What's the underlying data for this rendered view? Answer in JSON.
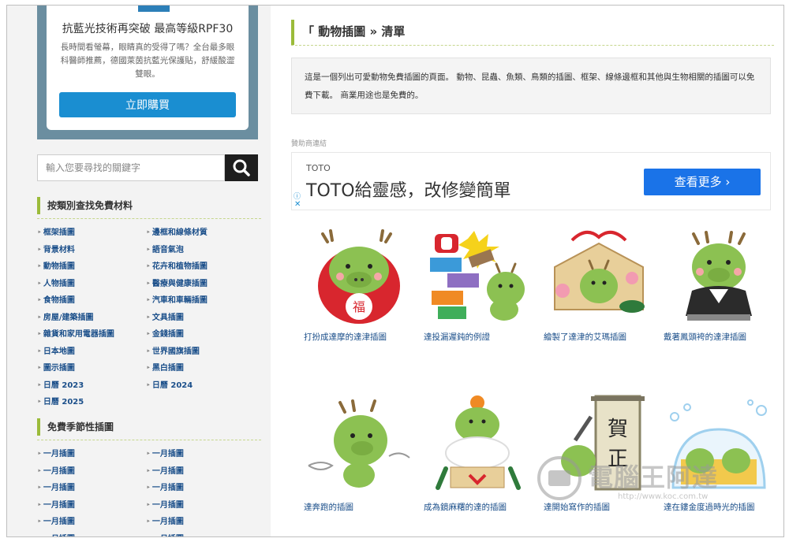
{
  "sidebar": {
    "ad": {
      "title": "抗藍光技術再突破 最高等級RPF30",
      "description": "長時間看螢幕，眼睛真的受得了嗎？全台最多眼科醫師推薦，德國萊茵抗藍光保護貼，舒緩酸澀雙眼。",
      "button": "立即購買"
    },
    "search": {
      "placeholder": "輸入您要尋找的關鍵字",
      "icon": "search-icon"
    },
    "categories_title": "按類別查找免費材料",
    "categories": [
      "框架插圖",
      "邊框和線條材質",
      "背景材料",
      "語音氣泡",
      "動物插圖",
      "花卉和植物插圖",
      "人物插圖",
      "醫療與健康插圖",
      "食物插圖",
      "汽車和車輛插圖",
      "房屋/建築插圖",
      "文具插圖",
      "雜貨和家用電器插圖",
      "金錢插圖",
      "日本地圖",
      "世界國旗插圖",
      "圖示插圖",
      "黑白插圖",
      "日曆 2023",
      "日曆 2024",
      "日曆 2025"
    ],
    "seasonal_title": "免費季節性插圖",
    "seasonal": [
      "一月插圖",
      "一月插圖",
      "一月插圖",
      "一月插圖",
      "一月插圖",
      "一月插圖",
      "一月插圖",
      "一月插圖",
      "一月插圖",
      "一月插圖",
      "一月插圖",
      "一月插圖"
    ]
  },
  "main": {
    "heading": "「 動物插圖 » 清單",
    "intro": "這是一個列出可愛動物免費插圖的頁面。 動物、昆蟲、魚類、鳥類的插圖、框架、線條邊框和其他與生物相關的插圖可以免費下載。 商業用途也是免費的。",
    "sponsor_label": "贊助商連結",
    "banner": {
      "brand": "TOTO",
      "title": "TOTO給靈感，改修變簡單",
      "cta": "查看更多",
      "info_icon": "ⓘ",
      "close_icon": "✕"
    },
    "tiles": [
      {
        "caption": "打扮成達摩的達津插圖",
        "icon": "dragon-daruma-illustration"
      },
      {
        "caption": "達投漏遲鈍的例證",
        "icon": "dragon-blocks-illustration"
      },
      {
        "caption": "繪製了達津的艾瑪插圖",
        "icon": "dragon-ema-illustration"
      },
      {
        "caption": "戴著鳳頭袴的達津插圖",
        "icon": "dragon-hakama-illustration"
      },
      {
        "caption": "達奔跑的插圖",
        "icon": "dragon-running-illustration"
      },
      {
        "caption": "成為鏡麻糬的達的插圖",
        "icon": "dragon-kagamimochi-illustration"
      },
      {
        "caption": "達開始寫作的插圖",
        "icon": "dragon-calligraphy-illustration"
      },
      {
        "caption": "達在鏤金度過時光的插圖",
        "icon": "dragon-bubble-illustration"
      }
    ],
    "watermark": {
      "text": "電腦王阿達",
      "url": "http://www.koc.com.tw"
    }
  },
  "colors": {
    "accent_green": "#9bbb3a",
    "link_blue": "#1b4f8a",
    "buy_button": "#1a8ed1",
    "cta_blue": "#1a73e8",
    "dragon_green": "#8cc152",
    "daruma_red": "#d8262e"
  }
}
